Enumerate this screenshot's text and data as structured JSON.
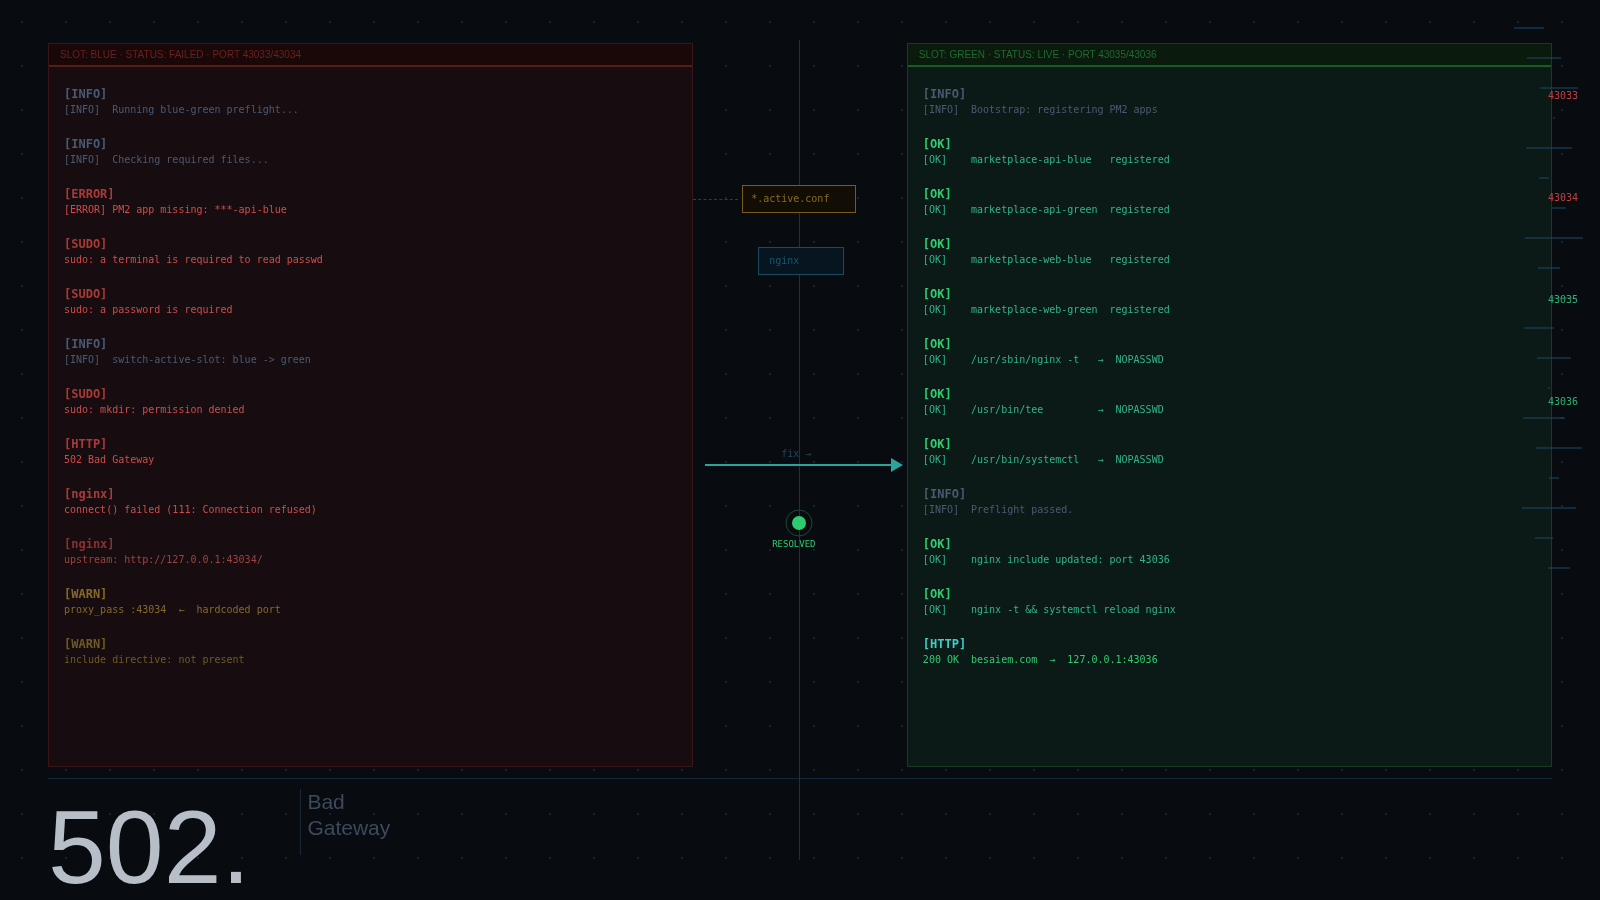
{
  "panels": [
    {
      "kind": "failed",
      "header": "SLOT: BLUE  ·  STATUS: FAILED  ·  PORT 43033/43034",
      "entries": [
        {
          "kind": "info",
          "tag": "[INFO]",
          "line": "[INFO]  Running blue-green preflight..."
        },
        {
          "kind": "info",
          "tag": "[INFO]",
          "line": "[INFO]  Checking required files..."
        },
        {
          "kind": "error",
          "tag": "[ERROR]",
          "line": "[ERROR] PM2 app missing: ***-api-blue"
        },
        {
          "kind": "error",
          "tag": "[SUDO]",
          "line": "sudo: a terminal is required to read passwd"
        },
        {
          "kind": "error",
          "tag": "[SUDO]",
          "line": "sudo: a password is required"
        },
        {
          "kind": "info",
          "tag": "[INFO]",
          "line": "[INFO]  switch-active-slot: blue -> green"
        },
        {
          "kind": "error",
          "tag": "[SUDO]",
          "line": "sudo: mkdir: permission denied"
        },
        {
          "kind": "error",
          "tag": "[HTTP]",
          "line": "502 Bad Gateway"
        },
        {
          "kind": "error",
          "tag": "[nginx]",
          "line": "connect() failed (111: Connection refused)"
        },
        {
          "kind": "muted-error",
          "tag": "[nginx]",
          "line": "upstream: http://127.0.0.1:43034/"
        },
        {
          "kind": "warn",
          "tag": "[WARN]",
          "line": "proxy_pass :43034  ←  hardcoded port"
        },
        {
          "kind": "dim-warn",
          "tag": "[WARN]",
          "line": "include directive: not present"
        }
      ]
    },
    {
      "kind": "live",
      "header": "SLOT: GREEN  ·  STATUS: LIVE  ·  PORT 43035/43036",
      "entries": [
        {
          "kind": "info",
          "tag": "[INFO]",
          "line": "[INFO]  Bootstrap: registering PM2 apps"
        },
        {
          "kind": "ok",
          "tag": "[OK]",
          "line": "[OK]    marketplace-api-blue   registered"
        },
        {
          "kind": "ok",
          "tag": "[OK]",
          "line": "[OK]    marketplace-api-green  registered"
        },
        {
          "kind": "ok",
          "tag": "[OK]",
          "line": "[OK]    marketplace-web-blue   registered"
        },
        {
          "kind": "ok",
          "tag": "[OK]",
          "line": "[OK]    marketplace-web-green  registered"
        },
        {
          "kind": "ok",
          "tag": "[OK]",
          "line": "[OK]    /usr/sbin/nginx -t   →  NOPASSWD"
        },
        {
          "kind": "ok",
          "tag": "[OK]",
          "line": "[OK]    /usr/bin/tee         →  NOPASSWD"
        },
        {
          "kind": "ok",
          "tag": "[OK]",
          "line": "[OK]    /usr/bin/systemctl   →  NOPASSWD"
        },
        {
          "kind": "info",
          "tag": "[INFO]",
          "line": "[INFO]  Preflight passed."
        },
        {
          "kind": "ok",
          "tag": "[OK]",
          "line": "[OK]    nginx include updated: port 43036"
        },
        {
          "kind": "ok",
          "tag": "[OK]",
          "line": "[OK]    nginx -t && systemctl reload nginx"
        },
        {
          "kind": "http-ok",
          "tag": "[HTTP]",
          "line": "200 OK  besaiem.com  →  127.0.0.1:43036"
        }
      ]
    }
  ],
  "flow": {
    "conf_file": "*.active.conf",
    "proxy": "nginx",
    "arrow_label": "fix →",
    "status": "RESOLVED"
  },
  "ports": [
    {
      "label": "43033",
      "color": "#c04040"
    },
    {
      "label": "43034",
      "color": "#c04040"
    },
    {
      "label": "43035",
      "color": "#30b070"
    },
    {
      "label": "43036",
      "color": "#30b070"
    }
  ],
  "error": {
    "code": "502.",
    "title": "Bad",
    "subtitle": "Gateway"
  }
}
